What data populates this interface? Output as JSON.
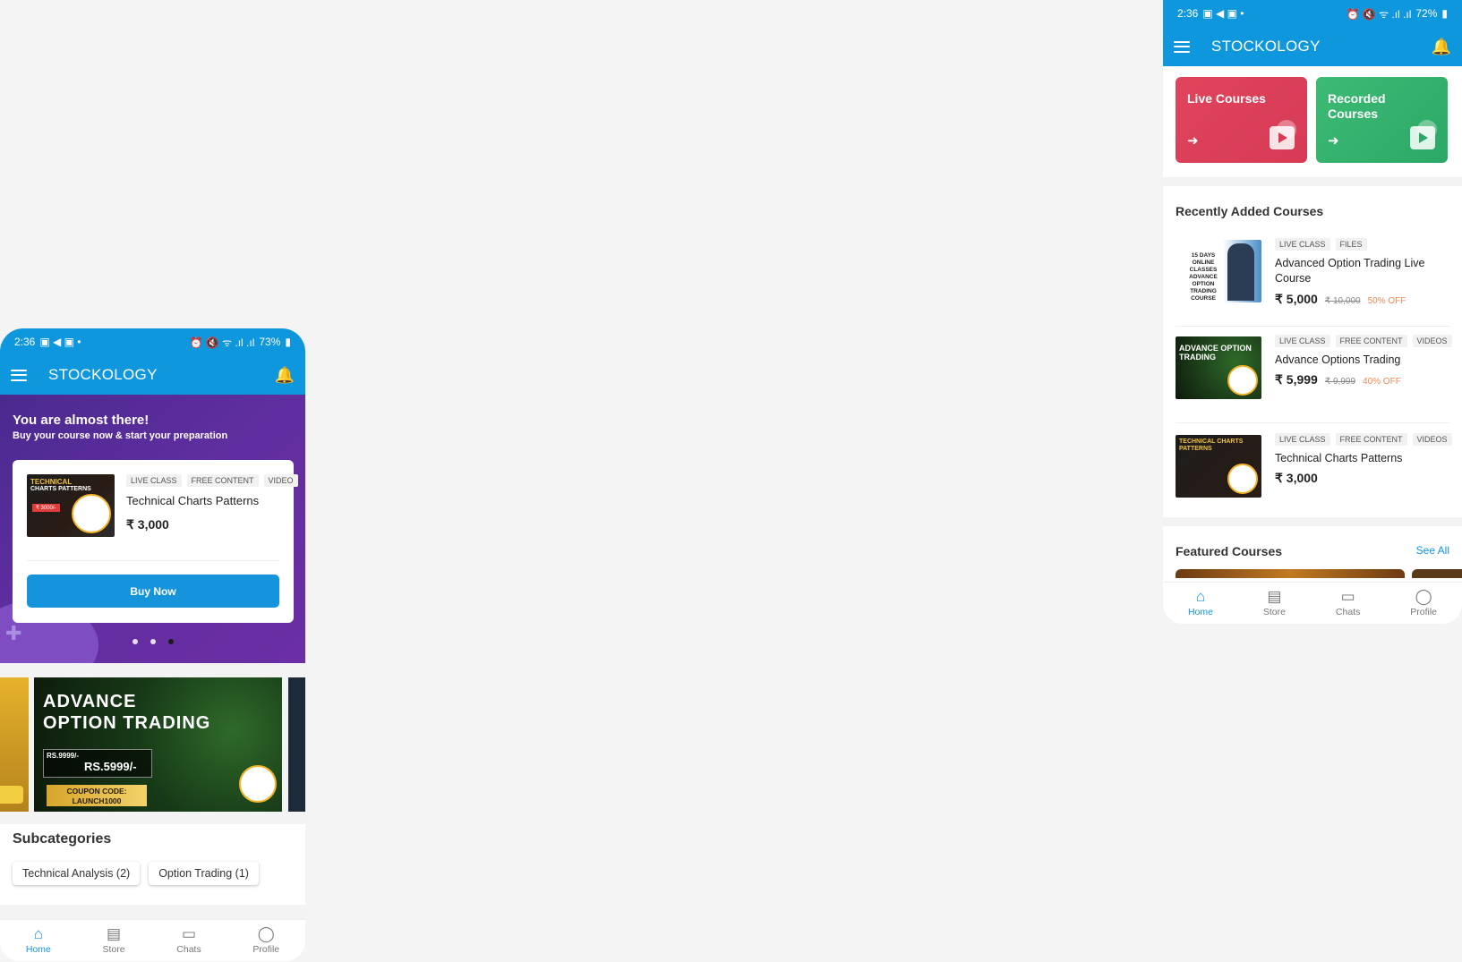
{
  "left": {
    "status": {
      "time": "2:36",
      "battery": "73%"
    },
    "appbar": {
      "title": "STOCKOLOGY"
    },
    "promo": {
      "title": "You are almost there!",
      "subtitle": "Buy your course now & start your preparation",
      "card": {
        "tags": [
          "LIVE CLASS",
          "FREE CONTENT",
          "VIDEO"
        ],
        "name": "Technical Charts Patterns",
        "price": "₹ 3,000",
        "button": "Buy Now",
        "thumb_text_1": "TECHNICAL",
        "thumb_text_2": "CHARTS PATTERNS"
      },
      "active_dot": 3
    },
    "banner": {
      "headline_1": "ADVANCE",
      "headline_2": "OPTION TRADING",
      "old_price": "RS.9999/-",
      "new_price": "RS.5999/-",
      "coupon_1": "COUPON CODE:",
      "coupon_2": "LAUNCH1000"
    },
    "subcategories": {
      "title": "Subcategories",
      "items": [
        "Technical Analysis (2)",
        "Option Trading (1)"
      ]
    }
  },
  "right": {
    "status": {
      "time": "2:36",
      "battery": "72%"
    },
    "appbar": {
      "title": "STOCKOLOGY"
    },
    "categories": [
      {
        "label": "Live Courses",
        "color": "#d63a55"
      },
      {
        "label": "Recorded Courses",
        "color": "#2ba866"
      }
    ],
    "recent": {
      "title": "Recently Added Courses",
      "courses": [
        {
          "tags": [
            "LIVE CLASS",
            "FILES"
          ],
          "name": "Advanced Option Trading Live Course",
          "price": "₹ 5,000",
          "was": "₹ 10,000",
          "off": "50% OFF",
          "thumb_text": "15 DAYS ONLINE CLASSES ADVANCE OPTION TRADING COURSE"
        },
        {
          "tags": [
            "LIVE CLASS",
            "FREE CONTENT",
            "VIDEOS"
          ],
          "name": "Advance Options Trading",
          "price": "₹ 5,999",
          "was": "₹ 9,999",
          "off": "40% OFF",
          "thumb_text": "ADVANCE OPTION TRADING"
        },
        {
          "tags": [
            "LIVE CLASS",
            "FREE CONTENT",
            "VIDEOS"
          ],
          "name": "Technical Charts Patterns",
          "price": "₹ 3,000",
          "thumb_text": "TECHNICAL CHARTS PATTERNS"
        }
      ]
    },
    "featured": {
      "title": "Featured Courses",
      "see_all": "See All"
    }
  },
  "nav": {
    "home": "Home",
    "store": "Store",
    "chats": "Chats",
    "profile": "Profile"
  },
  "colors": {
    "primary": "#0f97dd",
    "accent": "#1594dc"
  }
}
